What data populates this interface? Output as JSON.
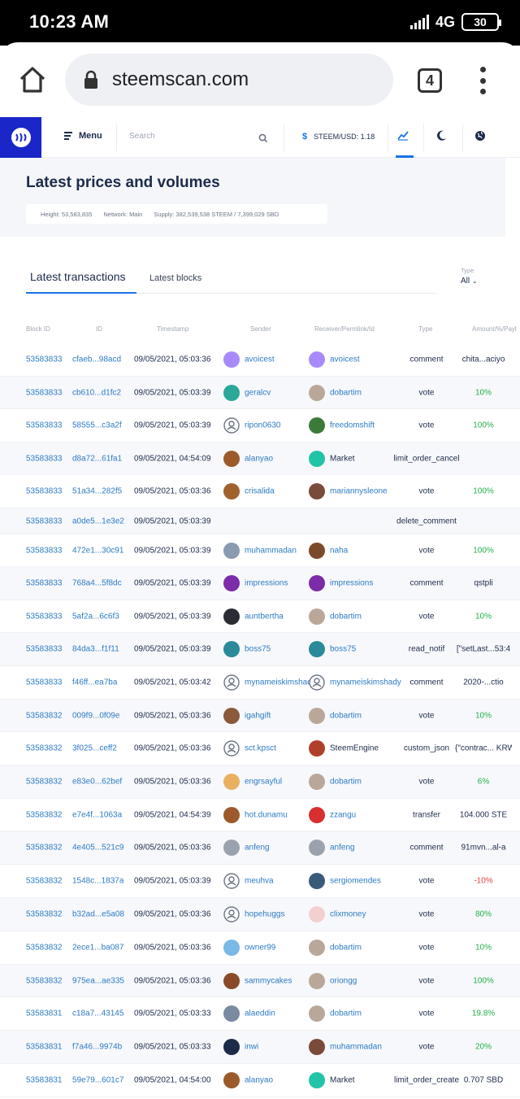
{
  "status": {
    "time": "10:23 AM",
    "network": "4G",
    "battery": "30"
  },
  "browser": {
    "url": "steemscan.com",
    "tab_count": "4"
  },
  "nav": {
    "menu_label": "Menu",
    "search_placeholder": "Search",
    "price_label": "STEEM/USD: 1.18"
  },
  "hero": {
    "title": "Latest prices and volumes",
    "height": "Height: 53,583,835",
    "network": "Network: Main",
    "supply": "Supply: 382,539,538 STEEM / 7,399,029 SBD"
  },
  "tabs": {
    "active": "Latest transactions",
    "other": "Latest blocks",
    "type_label": "Type",
    "type_value": "All"
  },
  "columns": [
    "Block ID",
    "ID",
    "Timestamp",
    "Sender",
    "Receiver/Permlink/Id",
    "Type",
    "Amount/%/Payl"
  ],
  "rows": [
    {
      "block": "53583833",
      "id": "cfaeb...98acd",
      "ts": "09/05/2021, 05:03:36",
      "sender": "avoicest",
      "s_av": "#a78bfa",
      "receiver": "avoicest",
      "r_av": "#a78bfa",
      "type": "comment",
      "amount": "chita...aciyo",
      "amt_style": "plain"
    },
    {
      "block": "53583833",
      "id": "cb610...d1fc2",
      "ts": "09/05/2021, 05:03:39",
      "sender": "geralcv",
      "s_av": "#2aa89a",
      "receiver": "dobartim",
      "r_av": "#b9a89a",
      "type": "vote",
      "amount": "10%",
      "amt_style": "green"
    },
    {
      "block": "53583833",
      "id": "58555...c3a2f",
      "ts": "09/05/2021, 05:03:39",
      "sender": "ripon0630",
      "s_av": "default",
      "receiver": "freedomshift",
      "r_av": "#3c7a3a",
      "type": "vote",
      "amount": "100%",
      "amt_style": "green"
    },
    {
      "block": "53583833",
      "id": "d8a72...61fa1",
      "ts": "09/05/2021, 04:54:09",
      "sender": "alanyao",
      "s_av": "#9c5a2a",
      "receiver": "Market",
      "r_av": "#22c4a8",
      "type": "limit_order_cancel",
      "amount": "",
      "amt_style": "plain"
    },
    {
      "block": "53583833",
      "id": "51a34...282f5",
      "ts": "09/05/2021, 05:03:36",
      "sender": "crisalida",
      "s_av": "#a0622d",
      "receiver": "mariannysleone",
      "r_av": "#7a4a3a",
      "type": "vote",
      "amount": "100%",
      "amt_style": "green"
    },
    {
      "block": "53583833",
      "id": "a0de5...1e3e2",
      "ts": "09/05/2021, 05:03:39",
      "sender": "",
      "s_av": "",
      "receiver": "",
      "r_av": "",
      "type": "delete_comment",
      "amount": "",
      "amt_style": "plain"
    },
    {
      "block": "53583833",
      "id": "472e1...30c91",
      "ts": "09/05/2021, 05:03:39",
      "sender": "muhammadan",
      "s_av": "#8a9ab0",
      "receiver": "naha",
      "r_av": "#7b4a2a",
      "type": "vote",
      "amount": "100%",
      "amt_style": "green"
    },
    {
      "block": "53583833",
      "id": "768a4...5f8dc",
      "ts": "09/05/2021, 05:03:39",
      "sender": "impressions",
      "s_av": "#7c2ca8",
      "receiver": "impressions",
      "r_av": "#7c2ca8",
      "type": "comment",
      "amount": "qstpli",
      "amt_style": "plain"
    },
    {
      "block": "53583833",
      "id": "5af2a...6c6f3",
      "ts": "09/05/2021, 05:03:39",
      "sender": "auntbertha",
      "s_av": "#2b2b33",
      "receiver": "dobartim",
      "r_av": "#b9a89a",
      "type": "vote",
      "amount": "10%",
      "amt_style": "green"
    },
    {
      "block": "53583833",
      "id": "84da3...f1f11",
      "ts": "09/05/2021, 05:03:39",
      "sender": "boss75",
      "s_av": "#2a8a9a",
      "receiver": "boss75",
      "r_av": "#2a8a9a",
      "type": "read_notif",
      "amount": "[\"setLast...53:4",
      "amt_style": "plain"
    },
    {
      "block": "53583833",
      "id": "f46ff...ea7ba",
      "ts": "09/05/2021, 05:03:42",
      "sender": "mynameiskimshady",
      "s_av": "default",
      "receiver": "mynameiskimshady",
      "r_av": "default",
      "type": "comment",
      "amount": "2020-...ctio",
      "amt_style": "plain"
    },
    {
      "block": "53583832",
      "id": "009f9...0f09e",
      "ts": "09/05/2021, 05:03:36",
      "sender": "igahgift",
      "s_av": "#8a5a3a",
      "receiver": "dobartim",
      "r_av": "#b9a89a",
      "type": "vote",
      "amount": "10%",
      "amt_style": "green"
    },
    {
      "block": "53583832",
      "id": "3f025...ceff2",
      "ts": "09/05/2021, 05:03:36",
      "sender": "sct.kpsct",
      "s_av": "default",
      "receiver": "SteemEngine",
      "r_av": "#b0402a",
      "type": "custom_json",
      "amount": "{\"contrac... KRWP\"}}",
      "amt_style": "plain"
    },
    {
      "block": "53583832",
      "id": "e83e0...62bef",
      "ts": "09/05/2021, 05:03:36",
      "sender": "engrsayful",
      "s_av": "#e8b060",
      "receiver": "dobartim",
      "r_av": "#b9a89a",
      "type": "vote",
      "amount": "6%",
      "amt_style": "green"
    },
    {
      "block": "53583832",
      "id": "e7e4f...1063a",
      "ts": "09/05/2021, 04:54:39",
      "sender": "hot.dunamu",
      "s_av": "#9c5a2a",
      "receiver": "zzangu",
      "r_av": "#d83030",
      "type": "transfer",
      "amount": "104.000 STE",
      "amt_style": "plain"
    },
    {
      "block": "53583832",
      "id": "4e405...521c9",
      "ts": "09/05/2021, 05:03:36",
      "sender": "anfeng",
      "s_av": "#9aa3ad",
      "receiver": "anfeng",
      "r_av": "#9aa3ad",
      "type": "comment",
      "amount": "91mvn...al-a",
      "amt_style": "plain"
    },
    {
      "block": "53583832",
      "id": "1548c...1837a",
      "ts": "09/05/2021, 05:03:39",
      "sender": "meuhva",
      "s_av": "default",
      "receiver": "sergiomendes",
      "r_av": "#3a5a7a",
      "type": "vote",
      "amount": "-10%",
      "amt_style": "red"
    },
    {
      "block": "53583832",
      "id": "b32ad...e5a08",
      "ts": "09/05/2021, 05:03:36",
      "sender": "hopehuggs",
      "s_av": "default",
      "receiver": "clixmoney",
      "r_av": "#f3d0d0",
      "type": "vote",
      "amount": "80%",
      "amt_style": "green"
    },
    {
      "block": "53583832",
      "id": "2ece1...ba087",
      "ts": "09/05/2021, 05:03:36",
      "sender": "owner99",
      "s_av": "#7ab8e8",
      "receiver": "dobartim",
      "r_av": "#b9a89a",
      "type": "vote",
      "amount": "10%",
      "amt_style": "green"
    },
    {
      "block": "53583832",
      "id": "975ea...ae335",
      "ts": "09/05/2021, 05:03:36",
      "sender": "sammycakes",
      "s_av": "#8a4a2a",
      "receiver": "oriongg",
      "r_av": "#b9a89a",
      "type": "vote",
      "amount": "100%",
      "amt_style": "green"
    },
    {
      "block": "53583831",
      "id": "c18a7...43145",
      "ts": "09/05/2021, 05:03:33",
      "sender": "alaeddin",
      "s_av": "#7a8aa0",
      "receiver": "dobartim",
      "r_av": "#b9a89a",
      "type": "vote",
      "amount": "19.8%",
      "amt_style": "green"
    },
    {
      "block": "53583831",
      "id": "f7a46...9974b",
      "ts": "09/05/2021, 05:03:33",
      "sender": "inwi",
      "s_av": "#1c2b4a",
      "receiver": "muhammadan",
      "r_av": "#7a4a3a",
      "type": "vote",
      "amount": "20%",
      "amt_style": "green"
    },
    {
      "block": "53583831",
      "id": "59e79...601c7",
      "ts": "09/05/2021, 04:54:00",
      "sender": "alanyao",
      "s_av": "#9c5a2a",
      "receiver": "Market",
      "r_av": "#22c4a8",
      "type": "limit_order_create",
      "amount": "0.707 SBD",
      "amt_style": "plain"
    }
  ]
}
